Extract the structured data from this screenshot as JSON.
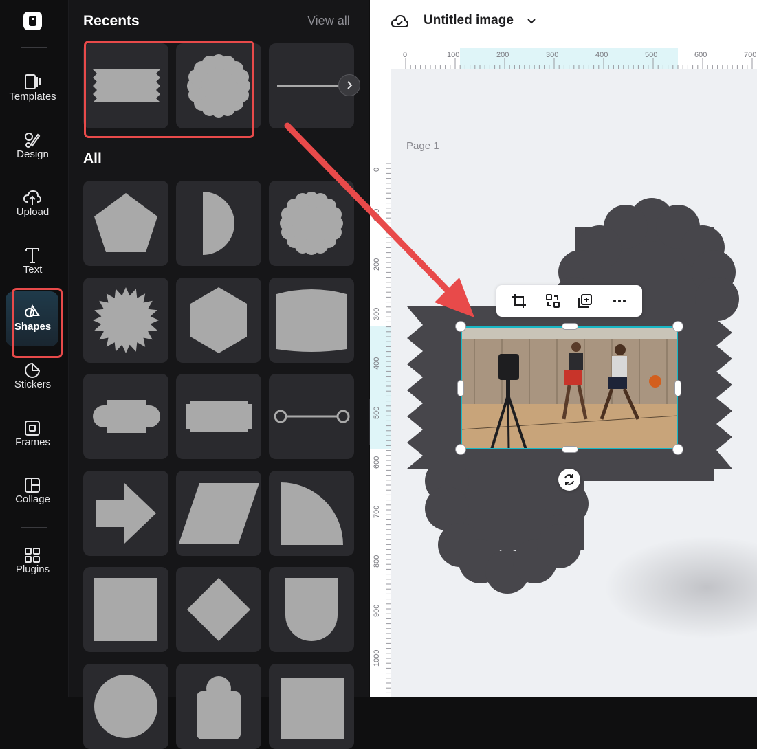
{
  "sidebar": {
    "items": [
      {
        "label": "Templates"
      },
      {
        "label": "Design"
      },
      {
        "label": "Upload"
      },
      {
        "label": "Text"
      },
      {
        "label": "Shapes"
      },
      {
        "label": "Stickers"
      },
      {
        "label": "Frames"
      },
      {
        "label": "Collage"
      },
      {
        "label": "Plugins"
      }
    ]
  },
  "panel": {
    "recents_heading": "Recents",
    "view_all": "View all",
    "all_heading": "All"
  },
  "document": {
    "title": "Untitled image",
    "page_label": "Page 1"
  },
  "ruler": {
    "horizontal": [
      "0",
      "100",
      "200",
      "300",
      "400",
      "500",
      "600",
      "700"
    ],
    "vertical": [
      "0",
      "100",
      "200",
      "300",
      "400",
      "500",
      "600",
      "700",
      "800",
      "900",
      "1000"
    ]
  },
  "colors": {
    "accent_highlight": "#e84a4a",
    "selection": "#19b8c6",
    "shape_fill": "#47464b",
    "panel_bg": "#161618",
    "tile_bg": "#2a2a2e"
  },
  "icons": {
    "toolbar": [
      "crop-icon",
      "replace-icon",
      "duplicate-icon",
      "more-icon"
    ],
    "header": [
      "cloud-save-icon",
      "chevron-down-icon"
    ]
  }
}
